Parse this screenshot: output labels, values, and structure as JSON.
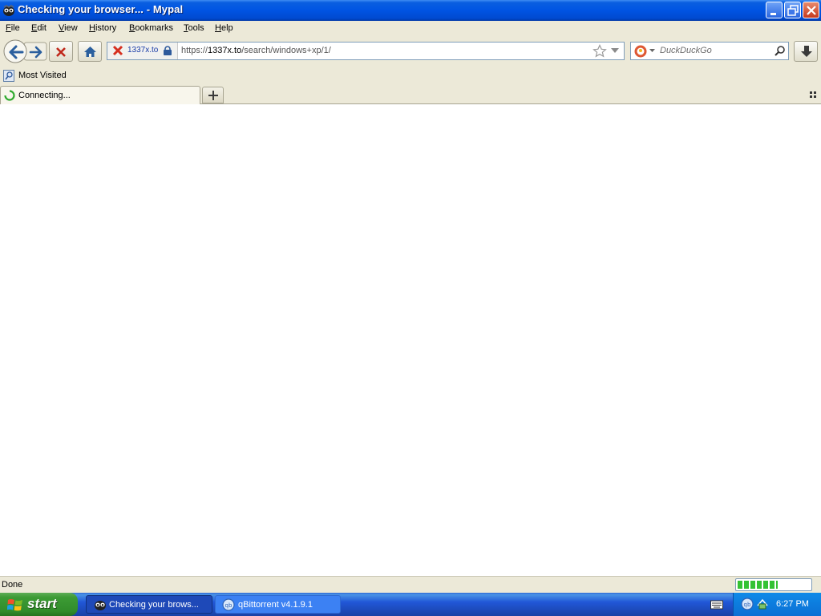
{
  "window": {
    "title": "Checking your browser... - Mypal"
  },
  "menu": {
    "items": [
      "File",
      "Edit",
      "View",
      "History",
      "Bookmarks",
      "Tools",
      "Help"
    ]
  },
  "navbar": {
    "identity_site": "1337x.to",
    "url_prefix": "https://",
    "url_host": "1337x.to",
    "url_path": "/search/windows+xp/1/",
    "search_placeholder": "DuckDuckGo"
  },
  "bookmarks": {
    "most_visited": "Most Visited"
  },
  "tabs": [
    {
      "label": "Connecting..."
    }
  ],
  "statusbar": {
    "text": "Done",
    "progress": 0.55
  },
  "taskbar": {
    "start_label": "start",
    "buttons": [
      {
        "label": "Checking your brows...",
        "active": true
      },
      {
        "label": "qBittorrent v4.1.9.1",
        "active": false
      }
    ],
    "clock": "6:27 PM"
  },
  "colors": {
    "title_bar": "#0054e3",
    "start_green": "#3c9b35",
    "tray_blue": "#0c6fd4",
    "spinner_green": "#2eaa2e"
  }
}
